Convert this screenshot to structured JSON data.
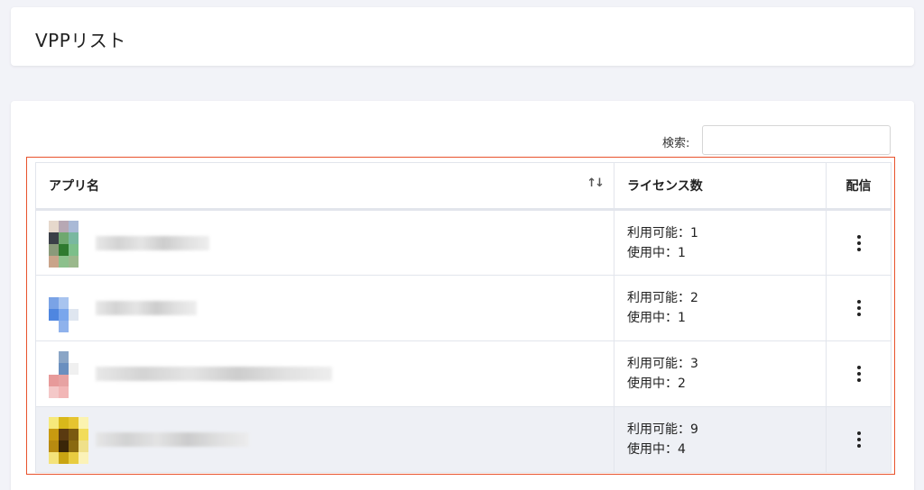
{
  "header": {
    "title": "VPPリスト"
  },
  "search": {
    "label": "検索:",
    "value": ""
  },
  "table": {
    "columns": [
      "アプリ名",
      "ライセンス数",
      "配信"
    ],
    "sort_icon": "sort-arrows-icon",
    "rows": [
      {
        "available": "利用可能：1",
        "in_use": "使用中：1",
        "icon_colors": [
          "#e6d8cc",
          "#b7a8b4",
          "#a9b9d6",
          "#ffffff",
          "#3b3f47",
          "#6fa86f",
          "#79b8a0",
          "#ffffff",
          "#8a9a7a",
          "#2f7a2f",
          "#7cbf8a",
          "#ffffff",
          "#c9a48a",
          "#8cc08c",
          "#9ab88c",
          "#ffffff"
        ]
      },
      {
        "available": "利用可能：2",
        "in_use": "使用中：1",
        "icon_colors": [
          "#ffffff",
          "#ffffff",
          "#ffffff",
          "#ffffff",
          "#7aa3e6",
          "#a8c4ef",
          "#ffffff",
          "#ffffff",
          "#4f86e0",
          "#7aa6ec",
          "#dfe6f0",
          "#ffffff",
          "#ffffff",
          "#8fb2ec",
          "#ffffff",
          "#ffffff"
        ]
      },
      {
        "available": "利用可能：3",
        "in_use": "使用中：2",
        "icon_colors": [
          "#ffffff",
          "#8aa5c6",
          "#ffffff",
          "#ffffff",
          "#ffffff",
          "#6a8fbf",
          "#f0f0f0",
          "#ffffff",
          "#e79a9a",
          "#e7a2a2",
          "#ffffff",
          "#ffffff",
          "#f4c8c8",
          "#f2b6b6",
          "#ffffff",
          "#ffffff"
        ]
      },
      {
        "available": "利用可能：9",
        "in_use": "使用中：4",
        "icon_colors": [
          "#f6e97a",
          "#d9b81a",
          "#e6c430",
          "#fbf3b0",
          "#c99a10",
          "#5a3a10",
          "#7a5a10",
          "#f2dc5a",
          "#b88a10",
          "#3a2608",
          "#8a6a10",
          "#efe08a",
          "#f4e27a",
          "#c9a412",
          "#e8cc40",
          "#fbf2b8"
        ]
      }
    ]
  },
  "colors": {
    "highlight_border": "#e8522c",
    "row_highlight": "#eef0f5"
  }
}
